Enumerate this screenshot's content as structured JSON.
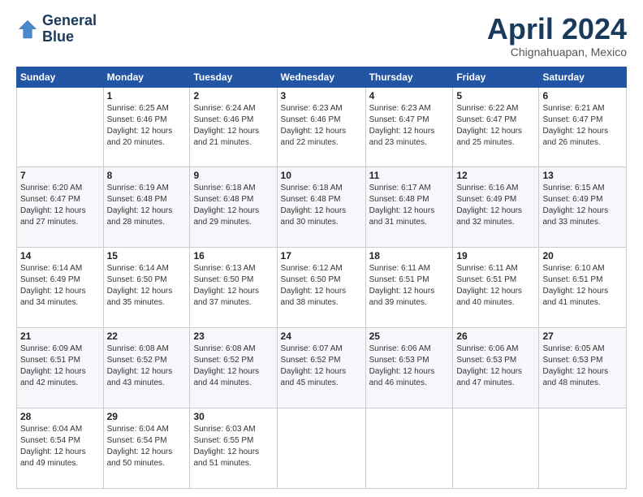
{
  "logo": {
    "line1": "General",
    "line2": "Blue"
  },
  "title": "April 2024",
  "subtitle": "Chignahuapan, Mexico",
  "days_of_week": [
    "Sunday",
    "Monday",
    "Tuesday",
    "Wednesday",
    "Thursday",
    "Friday",
    "Saturday"
  ],
  "weeks": [
    [
      {
        "day": "",
        "info": ""
      },
      {
        "day": "1",
        "info": "Sunrise: 6:25 AM\nSunset: 6:46 PM\nDaylight: 12 hours\nand 20 minutes."
      },
      {
        "day": "2",
        "info": "Sunrise: 6:24 AM\nSunset: 6:46 PM\nDaylight: 12 hours\nand 21 minutes."
      },
      {
        "day": "3",
        "info": "Sunrise: 6:23 AM\nSunset: 6:46 PM\nDaylight: 12 hours\nand 22 minutes."
      },
      {
        "day": "4",
        "info": "Sunrise: 6:23 AM\nSunset: 6:47 PM\nDaylight: 12 hours\nand 23 minutes."
      },
      {
        "day": "5",
        "info": "Sunrise: 6:22 AM\nSunset: 6:47 PM\nDaylight: 12 hours\nand 25 minutes."
      },
      {
        "day": "6",
        "info": "Sunrise: 6:21 AM\nSunset: 6:47 PM\nDaylight: 12 hours\nand 26 minutes."
      }
    ],
    [
      {
        "day": "7",
        "info": "Sunrise: 6:20 AM\nSunset: 6:47 PM\nDaylight: 12 hours\nand 27 minutes."
      },
      {
        "day": "8",
        "info": "Sunrise: 6:19 AM\nSunset: 6:48 PM\nDaylight: 12 hours\nand 28 minutes."
      },
      {
        "day": "9",
        "info": "Sunrise: 6:18 AM\nSunset: 6:48 PM\nDaylight: 12 hours\nand 29 minutes."
      },
      {
        "day": "10",
        "info": "Sunrise: 6:18 AM\nSunset: 6:48 PM\nDaylight: 12 hours\nand 30 minutes."
      },
      {
        "day": "11",
        "info": "Sunrise: 6:17 AM\nSunset: 6:48 PM\nDaylight: 12 hours\nand 31 minutes."
      },
      {
        "day": "12",
        "info": "Sunrise: 6:16 AM\nSunset: 6:49 PM\nDaylight: 12 hours\nand 32 minutes."
      },
      {
        "day": "13",
        "info": "Sunrise: 6:15 AM\nSunset: 6:49 PM\nDaylight: 12 hours\nand 33 minutes."
      }
    ],
    [
      {
        "day": "14",
        "info": "Sunrise: 6:14 AM\nSunset: 6:49 PM\nDaylight: 12 hours\nand 34 minutes."
      },
      {
        "day": "15",
        "info": "Sunrise: 6:14 AM\nSunset: 6:50 PM\nDaylight: 12 hours\nand 35 minutes."
      },
      {
        "day": "16",
        "info": "Sunrise: 6:13 AM\nSunset: 6:50 PM\nDaylight: 12 hours\nand 37 minutes."
      },
      {
        "day": "17",
        "info": "Sunrise: 6:12 AM\nSunset: 6:50 PM\nDaylight: 12 hours\nand 38 minutes."
      },
      {
        "day": "18",
        "info": "Sunrise: 6:11 AM\nSunset: 6:51 PM\nDaylight: 12 hours\nand 39 minutes."
      },
      {
        "day": "19",
        "info": "Sunrise: 6:11 AM\nSunset: 6:51 PM\nDaylight: 12 hours\nand 40 minutes."
      },
      {
        "day": "20",
        "info": "Sunrise: 6:10 AM\nSunset: 6:51 PM\nDaylight: 12 hours\nand 41 minutes."
      }
    ],
    [
      {
        "day": "21",
        "info": "Sunrise: 6:09 AM\nSunset: 6:51 PM\nDaylight: 12 hours\nand 42 minutes."
      },
      {
        "day": "22",
        "info": "Sunrise: 6:08 AM\nSunset: 6:52 PM\nDaylight: 12 hours\nand 43 minutes."
      },
      {
        "day": "23",
        "info": "Sunrise: 6:08 AM\nSunset: 6:52 PM\nDaylight: 12 hours\nand 44 minutes."
      },
      {
        "day": "24",
        "info": "Sunrise: 6:07 AM\nSunset: 6:52 PM\nDaylight: 12 hours\nand 45 minutes."
      },
      {
        "day": "25",
        "info": "Sunrise: 6:06 AM\nSunset: 6:53 PM\nDaylight: 12 hours\nand 46 minutes."
      },
      {
        "day": "26",
        "info": "Sunrise: 6:06 AM\nSunset: 6:53 PM\nDaylight: 12 hours\nand 47 minutes."
      },
      {
        "day": "27",
        "info": "Sunrise: 6:05 AM\nSunset: 6:53 PM\nDaylight: 12 hours\nand 48 minutes."
      }
    ],
    [
      {
        "day": "28",
        "info": "Sunrise: 6:04 AM\nSunset: 6:54 PM\nDaylight: 12 hours\nand 49 minutes."
      },
      {
        "day": "29",
        "info": "Sunrise: 6:04 AM\nSunset: 6:54 PM\nDaylight: 12 hours\nand 50 minutes."
      },
      {
        "day": "30",
        "info": "Sunrise: 6:03 AM\nSunset: 6:55 PM\nDaylight: 12 hours\nand 51 minutes."
      },
      {
        "day": "",
        "info": ""
      },
      {
        "day": "",
        "info": ""
      },
      {
        "day": "",
        "info": ""
      },
      {
        "day": "",
        "info": ""
      }
    ]
  ]
}
